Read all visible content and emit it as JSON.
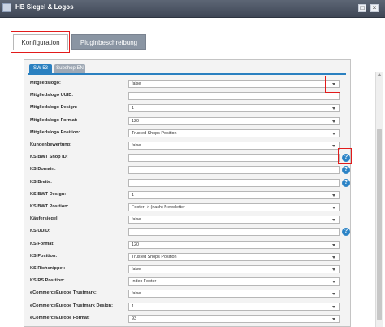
{
  "window": {
    "title": "HB Siegel & Logos",
    "maximize_icon": "maximize-icon",
    "close_icon": "close-icon"
  },
  "tabs": [
    {
      "label": "Konfiguration",
      "active": true
    },
    {
      "label": "Pluginbeschreibung",
      "active": false
    }
  ],
  "subtabs": [
    {
      "label": "SW 53",
      "active": true
    },
    {
      "label": "Subshop EN",
      "active": false
    }
  ],
  "colors": {
    "accent": "#2a80c0",
    "highlight": "#e21b1b",
    "titlebar": "#4a5362"
  },
  "form_rows": [
    {
      "label": "Mitgliedslogo:",
      "type": "select",
      "value": "false",
      "help": false
    },
    {
      "label": "Mitgliedslogo UUID:",
      "type": "text",
      "value": "",
      "help": false
    },
    {
      "label": "Mitgliedslogo Design:",
      "type": "select",
      "value": "1",
      "help": false
    },
    {
      "label": "Mitgliedslogo Format:",
      "type": "select",
      "value": "120",
      "help": false
    },
    {
      "label": "Mitgliedslogo Position:",
      "type": "select",
      "value": "Trusted Shops Position",
      "help": false
    },
    {
      "label": "Kundenbewertung:",
      "type": "select",
      "value": "false",
      "help": false
    },
    {
      "label": "KS BWT Shop ID:",
      "type": "text",
      "value": "",
      "help": true
    },
    {
      "label": "KS Domain:",
      "type": "text",
      "value": "",
      "help": true
    },
    {
      "label": "KS Breite:",
      "type": "text",
      "value": "",
      "help": true
    },
    {
      "label": "KS BWT Design:",
      "type": "select",
      "value": "1",
      "help": false
    },
    {
      "label": "KS BWT Position:",
      "type": "select",
      "value": "Footer -> (nach) Newsletter",
      "help": false
    },
    {
      "label": "Käufersiegel:",
      "type": "select",
      "value": "false",
      "help": false
    },
    {
      "label": "KS UUID:",
      "type": "text",
      "value": "",
      "help": true
    },
    {
      "label": "KS Format:",
      "type": "select",
      "value": "120",
      "help": false
    },
    {
      "label": "KS Position:",
      "type": "select",
      "value": "Trusted Shops Position",
      "help": false
    },
    {
      "label": "KS Richsnippet:",
      "type": "select",
      "value": "false",
      "help": false
    },
    {
      "label": "KS RS Position:",
      "type": "select",
      "value": "Index Footer",
      "help": false
    },
    {
      "label": "eCommerceEurope Trustmark:",
      "type": "select",
      "value": "false",
      "help": false
    },
    {
      "label": "eCommerceEurope Trustmark Design:",
      "type": "select",
      "value": "1",
      "help": false
    },
    {
      "label": "eCommerceEurope Format:",
      "type": "select",
      "value": "93",
      "help": false
    },
    {
      "label": "",
      "type": "select",
      "value": "",
      "help": false
    }
  ],
  "help_glyph": "?"
}
